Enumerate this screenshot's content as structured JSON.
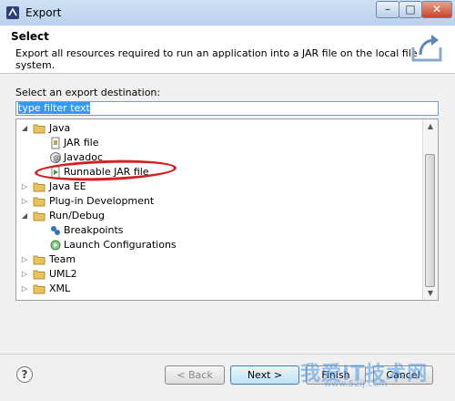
{
  "window": {
    "title": "Export",
    "minimize_glyph": "–",
    "maximize_glyph": "□",
    "close_glyph": "✕"
  },
  "header": {
    "title": "Select",
    "description": "Export all resources required to run an application into a JAR file on the local file system.",
    "icon": "export-icon"
  },
  "destination": {
    "label": "Select an export destination:",
    "filter_value": "type filter text"
  },
  "tree": {
    "items": [
      {
        "label": "Java",
        "expanded": true,
        "icon": "folder-icon"
      },
      {
        "label": "JAR file",
        "icon": "jar-icon"
      },
      {
        "label": "Javadoc",
        "icon": "javadoc-icon"
      },
      {
        "label": "Runnable JAR file",
        "icon": "runnable-jar-icon"
      },
      {
        "label": "Java EE",
        "expanded": false,
        "icon": "folder-icon"
      },
      {
        "label": "Plug-in Development",
        "expanded": false,
        "icon": "folder-icon"
      },
      {
        "label": "Run/Debug",
        "expanded": true,
        "icon": "folder-icon"
      },
      {
        "label": "Breakpoints",
        "icon": "breakpoints-icon"
      },
      {
        "label": "Launch Configurations",
        "icon": "launch-config-icon"
      },
      {
        "label": "Team",
        "expanded": false,
        "icon": "folder-icon"
      },
      {
        "label": "UML2",
        "expanded": false,
        "icon": "folder-icon"
      },
      {
        "label": "XML",
        "expanded": false,
        "icon": "folder-icon"
      }
    ]
  },
  "buttons": {
    "help": "?",
    "back": "< Back",
    "next": "Next >",
    "finish": "Finish",
    "cancel": "Cancel"
  },
  "watermark": {
    "text": "我爱IT技术网",
    "url": "www.52ij.com"
  },
  "colors": {
    "selection": "#3399ff",
    "highlight_ellipse": "#d42020",
    "folder": "#e8c25a"
  }
}
